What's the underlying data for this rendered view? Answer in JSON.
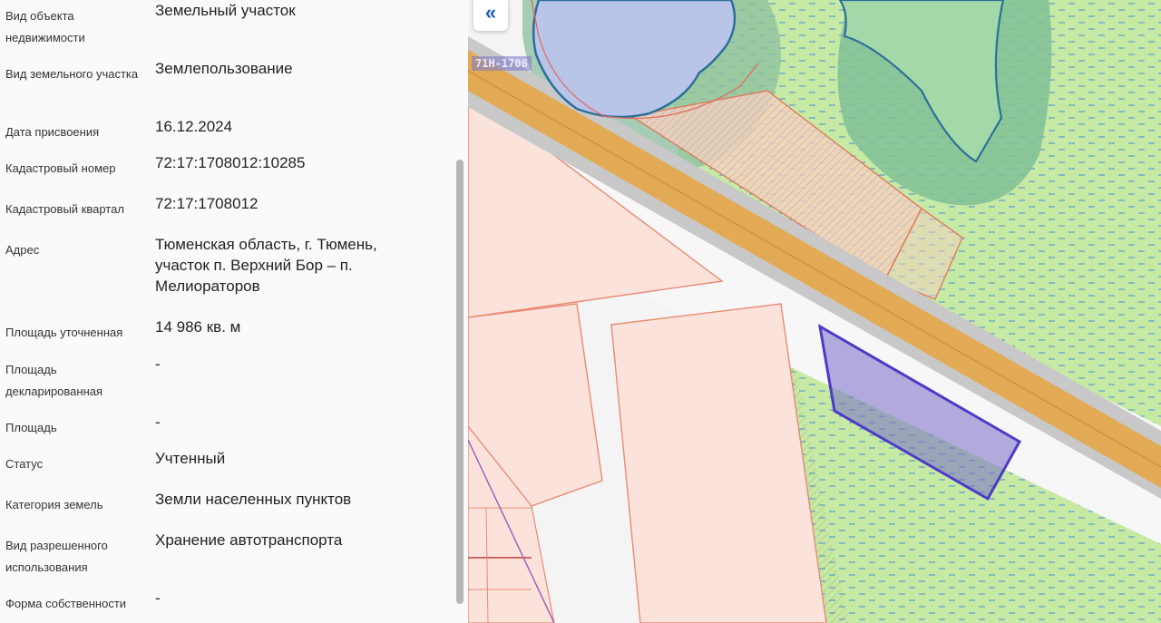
{
  "properties": [
    {
      "label": "Вид объекта недвижимости",
      "value": "Земельный участок"
    },
    {
      "label": "Вид земельного участка",
      "value": "Землепользование"
    },
    {
      "label": "Дата присвоения",
      "value": "16.12.2024"
    },
    {
      "label": "Кадастровый номер",
      "value": "72:17:1708012:10285"
    },
    {
      "label": "Кадастровый квартал",
      "value": "72:17:1708012"
    },
    {
      "label": "Адрес",
      "value": "Тюменская область, г. Тюмень, участок п. Верхний Бор – п. Мелиораторов"
    },
    {
      "label": "Площадь уточненная",
      "value": "14 986 кв. м"
    },
    {
      "label": "Площадь декларированная",
      "value": "-"
    },
    {
      "label": "Площадь",
      "value": "-"
    },
    {
      "label": "Статус",
      "value": "Учтенный"
    },
    {
      "label": "Категория земель",
      "value": "Земли населенных пунктов"
    },
    {
      "label": "Вид разрешенного использования",
      "value": "Хранение автотранспорта"
    },
    {
      "label": "Форма собственности",
      "value": "-"
    }
  ],
  "map": {
    "collapse_icon": "chevrons-left-icon",
    "collapse_glyph": "«",
    "road_label": "71Н-1706"
  }
}
